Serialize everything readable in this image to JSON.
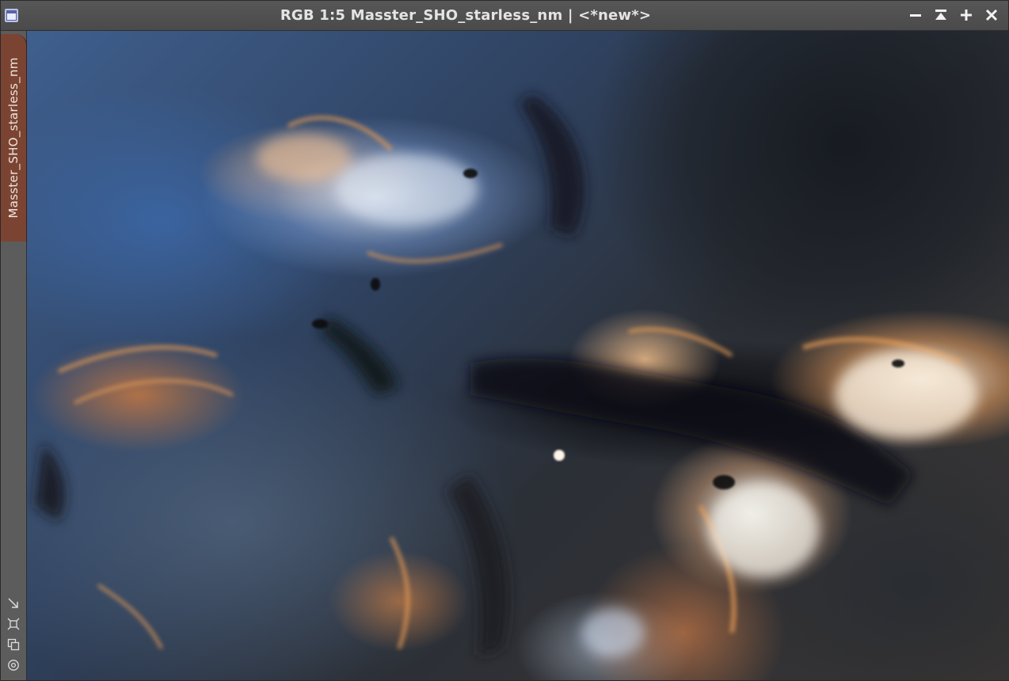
{
  "window": {
    "title": "RGB 1:5 Masster_SHO_starless_nm | <*new*>",
    "icon": "image-window-icon",
    "controls": [
      {
        "name": "minimize-button",
        "icon": "minimize-icon"
      },
      {
        "name": "shade-button",
        "icon": "shade-icon"
      },
      {
        "name": "maximize-button",
        "icon": "plus-icon"
      },
      {
        "name": "close-button",
        "icon": "close-icon"
      }
    ]
  },
  "sidebar": {
    "tab_label": "Masster_SHO_starless_nm",
    "tab_color": "#7b4432",
    "tools": [
      {
        "name": "fit-view-button",
        "icon": "arrow-diagonal-icon"
      },
      {
        "name": "zoom-to-fit-button",
        "icon": "frame-corners-icon"
      },
      {
        "name": "clone-button",
        "icon": "overlap-squares-icon"
      },
      {
        "name": "preview-button",
        "icon": "target-circle-icon"
      }
    ]
  },
  "image": {
    "description_type": "SHO narrowband nebula image",
    "colors": {
      "blue": "#3f5f8e",
      "orange": "#d98a45",
      "dark": "#1a1c22"
    }
  }
}
